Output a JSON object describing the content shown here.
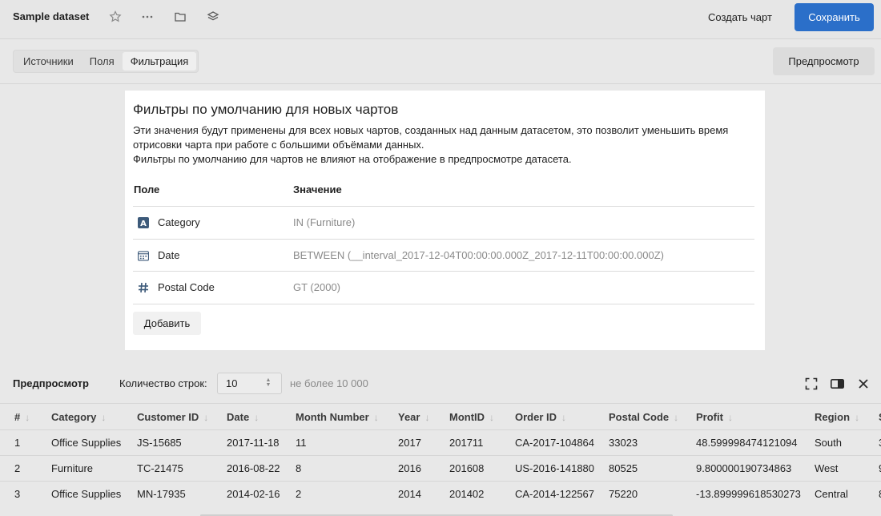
{
  "header": {
    "dataset_title": "Sample dataset",
    "create_chart_label": "Создать чарт",
    "save_label": "Сохранить"
  },
  "tabs": [
    {
      "label": "Источники",
      "active": false
    },
    {
      "label": "Поля",
      "active": false
    },
    {
      "label": "Фильтрация",
      "active": true
    }
  ],
  "preview_button_label": "Предпросмотр",
  "dialog": {
    "title": "Фильтры по умолчанию для новых чартов",
    "description_line1": "Эти значения будут применены для всех новых чартов, созданных над данным датасетом, это позволит уменьшить время",
    "description_line2": "отрисовки чарта при работе с большими объёмами данных.",
    "description_line3": "Фильтры по умолчанию для чартов не влияют на отображение в предпросмотре датасета.",
    "col_field": "Поле",
    "col_value": "Значение",
    "filters": [
      {
        "icon": "text-type-icon",
        "field": "Category",
        "value": "IN (Furniture)"
      },
      {
        "icon": "calendar-icon",
        "field": "Date",
        "value": "BETWEEN (__interval_2017-12-04T00:00:00.000Z_2017-12-11T00:00:00.000Z)"
      },
      {
        "icon": "hash-icon",
        "field": "Postal Code",
        "value": "GT (2000)"
      }
    ],
    "add_label": "Добавить"
  },
  "preview": {
    "title": "Предпросмотр",
    "rows_label": "Количество строк:",
    "rows_value": "10",
    "rows_hint": "не более 10 000"
  },
  "table": {
    "columns": [
      "#",
      "Category",
      "Customer ID",
      "Date",
      "Month Number",
      "Year",
      "MontID",
      "Order ID",
      "Postal Code",
      "Profit",
      "Region",
      "S"
    ],
    "rows": [
      [
        "1",
        "Office Supplies",
        "JS-15685",
        "2017-11-18",
        "11",
        "2017",
        "201711",
        "CA-2017-104864",
        "33023",
        "48.599998474121094",
        "South",
        "3"
      ],
      [
        "2",
        "Furniture",
        "TC-21475",
        "2016-08-22",
        "8",
        "2016",
        "201608",
        "US-2016-141880",
        "80525",
        "9.800000190734863",
        "West",
        "9"
      ],
      [
        "3",
        "Office Supplies",
        "MN-17935",
        "2014-02-16",
        "2",
        "2014",
        "201402",
        "CA-2014-122567",
        "75220",
        "-13.899999618530273",
        "Central",
        "8"
      ]
    ]
  },
  "colors": {
    "accent": "#2b6fc9",
    "background": "#e8e8e8",
    "dialog": "#ffffff"
  }
}
